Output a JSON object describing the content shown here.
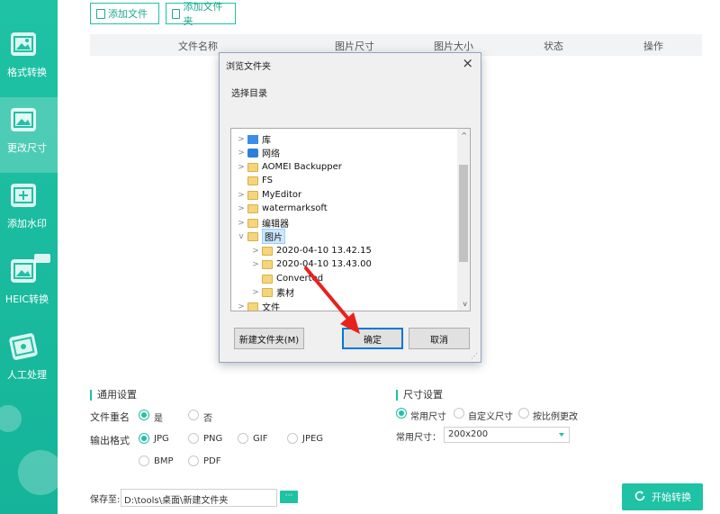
{
  "sidebar": {
    "items": [
      {
        "label": "格式转换",
        "icon": "image-convert-icon"
      },
      {
        "label": "更改尺寸",
        "icon": "image-resize-icon"
      },
      {
        "label": "添加水印",
        "icon": "watermark-icon"
      },
      {
        "label": "HEIC转换",
        "icon": "heic-icon"
      },
      {
        "label": "人工处理",
        "icon": "manual-process-icon"
      }
    ]
  },
  "toolbar": {
    "add_file": "添加文件",
    "add_folder": "添加文件夹"
  },
  "table": {
    "columns": [
      "文件名称",
      "图片尺寸",
      "图片大小",
      "状态",
      "操作"
    ]
  },
  "dialog": {
    "title": "浏览文件夹",
    "description": "选择目录",
    "tree": [
      {
        "label": "库",
        "level": 0,
        "icon": "library-icon",
        "expandable": true
      },
      {
        "label": "网络",
        "level": 0,
        "icon": "network-icon",
        "expandable": true
      },
      {
        "label": "AOMEI Backupper",
        "level": 0,
        "icon": "folder-icon",
        "expandable": true
      },
      {
        "label": "FS",
        "level": 0,
        "icon": "folder-icon",
        "expandable": false
      },
      {
        "label": "MyEditor",
        "level": 0,
        "icon": "folder-icon",
        "expandable": true
      },
      {
        "label": "watermarksoft",
        "level": 0,
        "icon": "folder-icon",
        "expandable": true
      },
      {
        "label": "编辑器",
        "level": 0,
        "icon": "folder-icon",
        "expandable": true
      },
      {
        "label": "图片",
        "level": 0,
        "icon": "folder-icon",
        "expandable": true,
        "expanded": true,
        "selected": true
      },
      {
        "label": "2020-04-10 13.42.15",
        "level": 1,
        "icon": "folder-icon",
        "expandable": true
      },
      {
        "label": "2020-04-10 13.43.00",
        "level": 1,
        "icon": "folder-icon",
        "expandable": true
      },
      {
        "label": "Converted",
        "level": 1,
        "icon": "folder-icon",
        "expandable": false
      },
      {
        "label": "素材",
        "level": 1,
        "icon": "folder-icon",
        "expandable": true
      },
      {
        "label": "文件",
        "level": 0,
        "icon": "folder-icon",
        "expandable": true
      }
    ],
    "new_folder_button": "新建文件夹(M)",
    "ok_button": "确定",
    "cancel_button": "取消"
  },
  "general_settings": {
    "title": "通用设置",
    "rename_label": "文件重名",
    "rename_yes": "是",
    "rename_no": "否",
    "rename_selected": "是",
    "format_label": "输出格式",
    "formats": [
      "JPG",
      "PNG",
      "GIF",
      "JPEG",
      "BMP",
      "PDF"
    ],
    "format_selected": "JPG"
  },
  "size_settings": {
    "title": "尺寸设置",
    "modes": [
      "常用尺寸",
      "自定义尺寸",
      "按比例更改"
    ],
    "mode_selected": "常用尺寸",
    "common_size_label": "常用尺寸：",
    "common_size_value": "200x200"
  },
  "output": {
    "save_label": "保存至:",
    "path": "D:\\tools\\桌面\\新建文件夹",
    "browse_button": "···",
    "start_button": "开始转换"
  },
  "colors": {
    "accent": "#1fc2a4",
    "annotation_arrow": "#e8221b",
    "selection": "#cce8ff"
  }
}
